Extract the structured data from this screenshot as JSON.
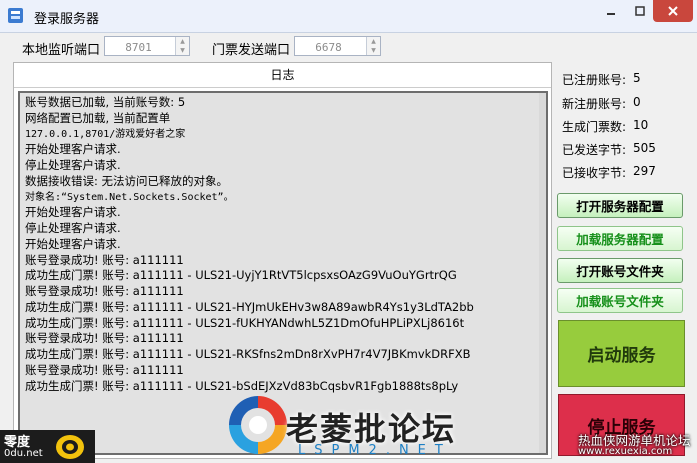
{
  "window": {
    "title": "登录服务器",
    "icon": "server-app-icon"
  },
  "controls": {
    "listen_port_label": "本地监听端口",
    "listen_port_value": "8701",
    "ticket_port_label": "门票发送端口",
    "ticket_port_value": "6678"
  },
  "log": {
    "header": "日志",
    "lines": [
      "账号数据已加载, 当前账号数: 5",
      "网络配置已加载, 当前配置单",
      "127.0.0.1,8701/游戏爱好者之家",
      "开始处理客户请求.",
      "停止处理客户请求.",
      "数据接收错误: 无法访问已释放的对象。",
      "对象名:“System.Net.Sockets.Socket”。",
      "开始处理客户请求.",
      "停止处理客户请求.",
      "开始处理客户请求.",
      "账号登录成功! 账号: a111111",
      "成功生成门票! 账号: a111111 - ULS21-UyjY1RtVT5lcpsxsOAzG9VuOuYGrtrQG",
      "账号登录成功! 账号: a111111",
      "成功生成门票! 账号: a111111 - ULS21-HYJmUkEHv3w8A89awbR4Ys1y3LdTA2bb",
      "成功生成门票! 账号: a111111 - ULS21-fUKHYANdwhL5Z1DmOfuHPLiPXLj8616t",
      "账号登录成功! 账号: a111111",
      "成功生成门票! 账号: a111111 - ULS21-RKSfns2mDn8rXvPH7r4V7JBKmvkDRFXB",
      "账号登录成功! 账号: a111111",
      "成功生成门票! 账号: a111111 - ULS21-bSdEJXzVd83bCqsbvR1Fgb1888ts8pLy"
    ]
  },
  "stats": [
    {
      "label": "已注册账号:",
      "value": "5"
    },
    {
      "label": "新注册账号:",
      "value": "0"
    },
    {
      "label": "生成门票数:",
      "value": "10"
    },
    {
      "label": "已发送字节:",
      "value": "505"
    },
    {
      "label": "已接收字节:",
      "value": "297"
    }
  ],
  "buttons": {
    "open_server_config": "打开服务器配置",
    "load_server_config": "加载服务器配置",
    "open_account_file": "打开账号文件夹",
    "load_account_file": "加载账号文件夹",
    "start_service": "启动服务",
    "stop_service": "停止服务"
  },
  "watermarks": {
    "site_title": "老菱批论坛",
    "site_sub": "LSPM2.NET",
    "right_line1": "热血侠网游单机论坛",
    "right_line2": "www.rexuexia.com",
    "badge_line1": "零度",
    "badge_line2": "0du.net"
  },
  "colors": {
    "start": "#97cc3d",
    "stop": "#dd2f4b",
    "close": "#c9473d"
  }
}
